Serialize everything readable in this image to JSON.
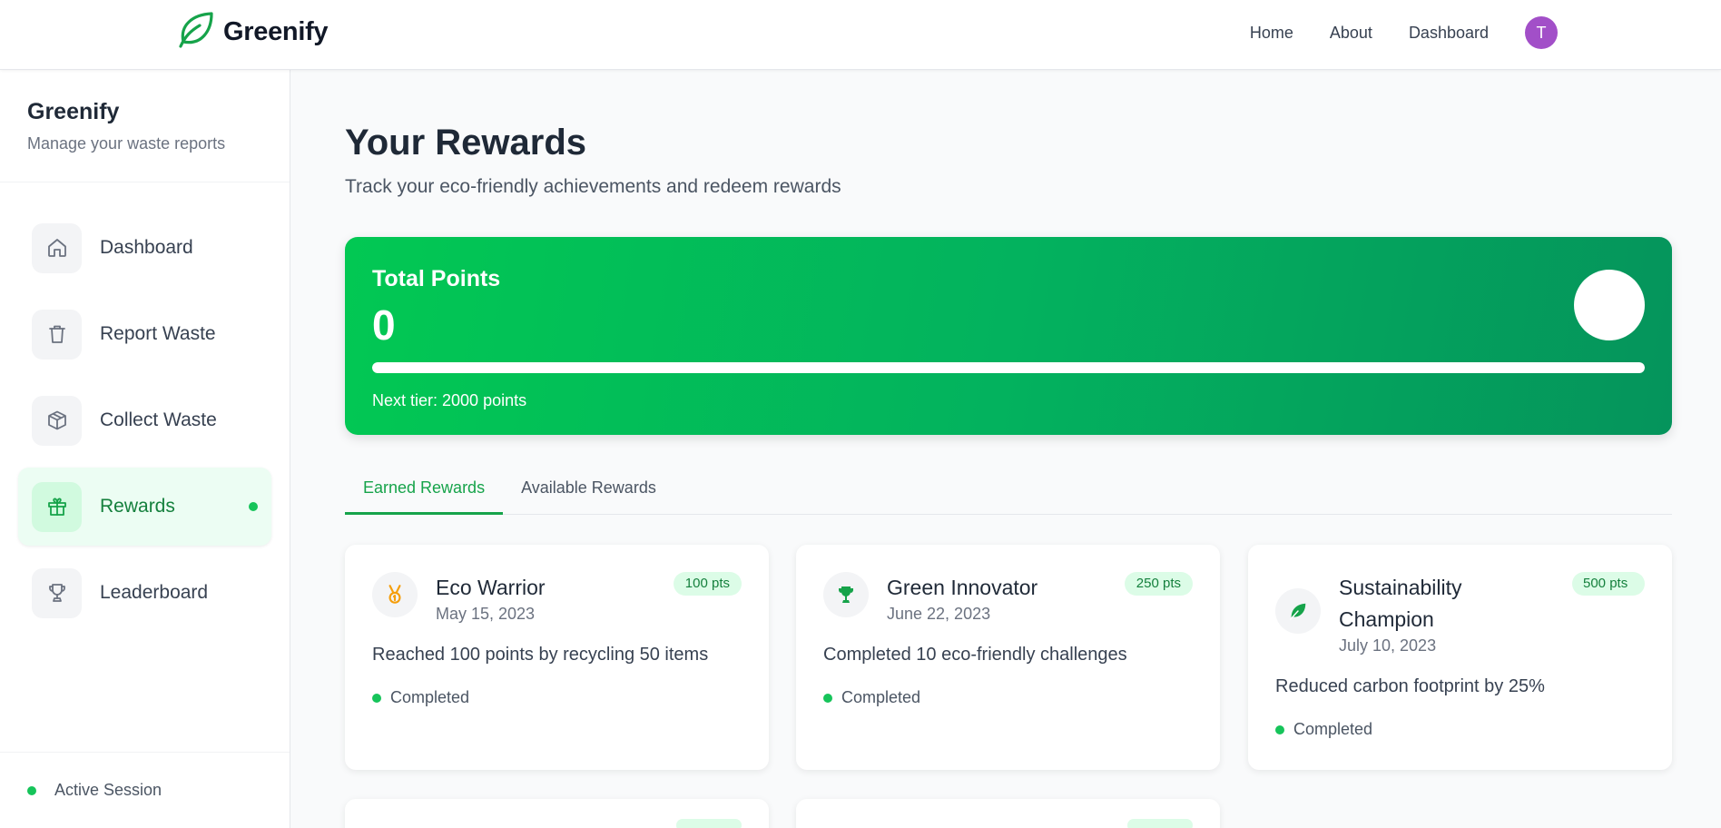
{
  "topnav": {
    "brand": "Greenify",
    "links": [
      "Home",
      "About",
      "Dashboard"
    ],
    "avatar_initial": "T",
    "avatar_color": "#a24fc8"
  },
  "sidebar": {
    "title": "Greenify",
    "subtitle": "Manage your waste reports",
    "items": [
      {
        "label": "Dashboard",
        "icon": "home-icon"
      },
      {
        "label": "Report Waste",
        "icon": "trash-icon"
      },
      {
        "label": "Collect Waste",
        "icon": "package-icon"
      },
      {
        "label": "Rewards",
        "icon": "gift-icon",
        "active": true
      },
      {
        "label": "Leaderboard",
        "icon": "trophy-icon"
      }
    ],
    "footer": "Active Session"
  },
  "main": {
    "title": "Your Rewards",
    "subtitle": "Track your eco-friendly achievements and redeem rewards",
    "points": {
      "label": "Total Points",
      "value": "0",
      "next_tier": "Next tier: 2000 points",
      "progress": 1.0
    },
    "tabs": [
      {
        "label": "Earned Rewards",
        "active": true
      },
      {
        "label": "Available Rewards",
        "active": false
      }
    ],
    "cards": [
      {
        "title": "Eco Warrior",
        "date": "May 15, 2023",
        "points": "100 pts",
        "description": "Reached 100 points by recycling 50 items",
        "status": "Completed",
        "icon": "medal-icon"
      },
      {
        "title": "Green Innovator",
        "date": "June 22, 2023",
        "points": "250 pts",
        "description": "Completed 10 eco-friendly challenges",
        "status": "Completed",
        "icon": "trophy-icon"
      },
      {
        "title": "Sustainability Champion",
        "date": "July 10, 2023",
        "points": "500 pts",
        "description": "Reduced carbon footprint by 25%",
        "status": "Completed",
        "icon": "leaf-icon"
      }
    ]
  },
  "colors": {
    "accent": "#16a34a",
    "gradient_start": "#02c853",
    "gradient_end": "#05945c"
  }
}
